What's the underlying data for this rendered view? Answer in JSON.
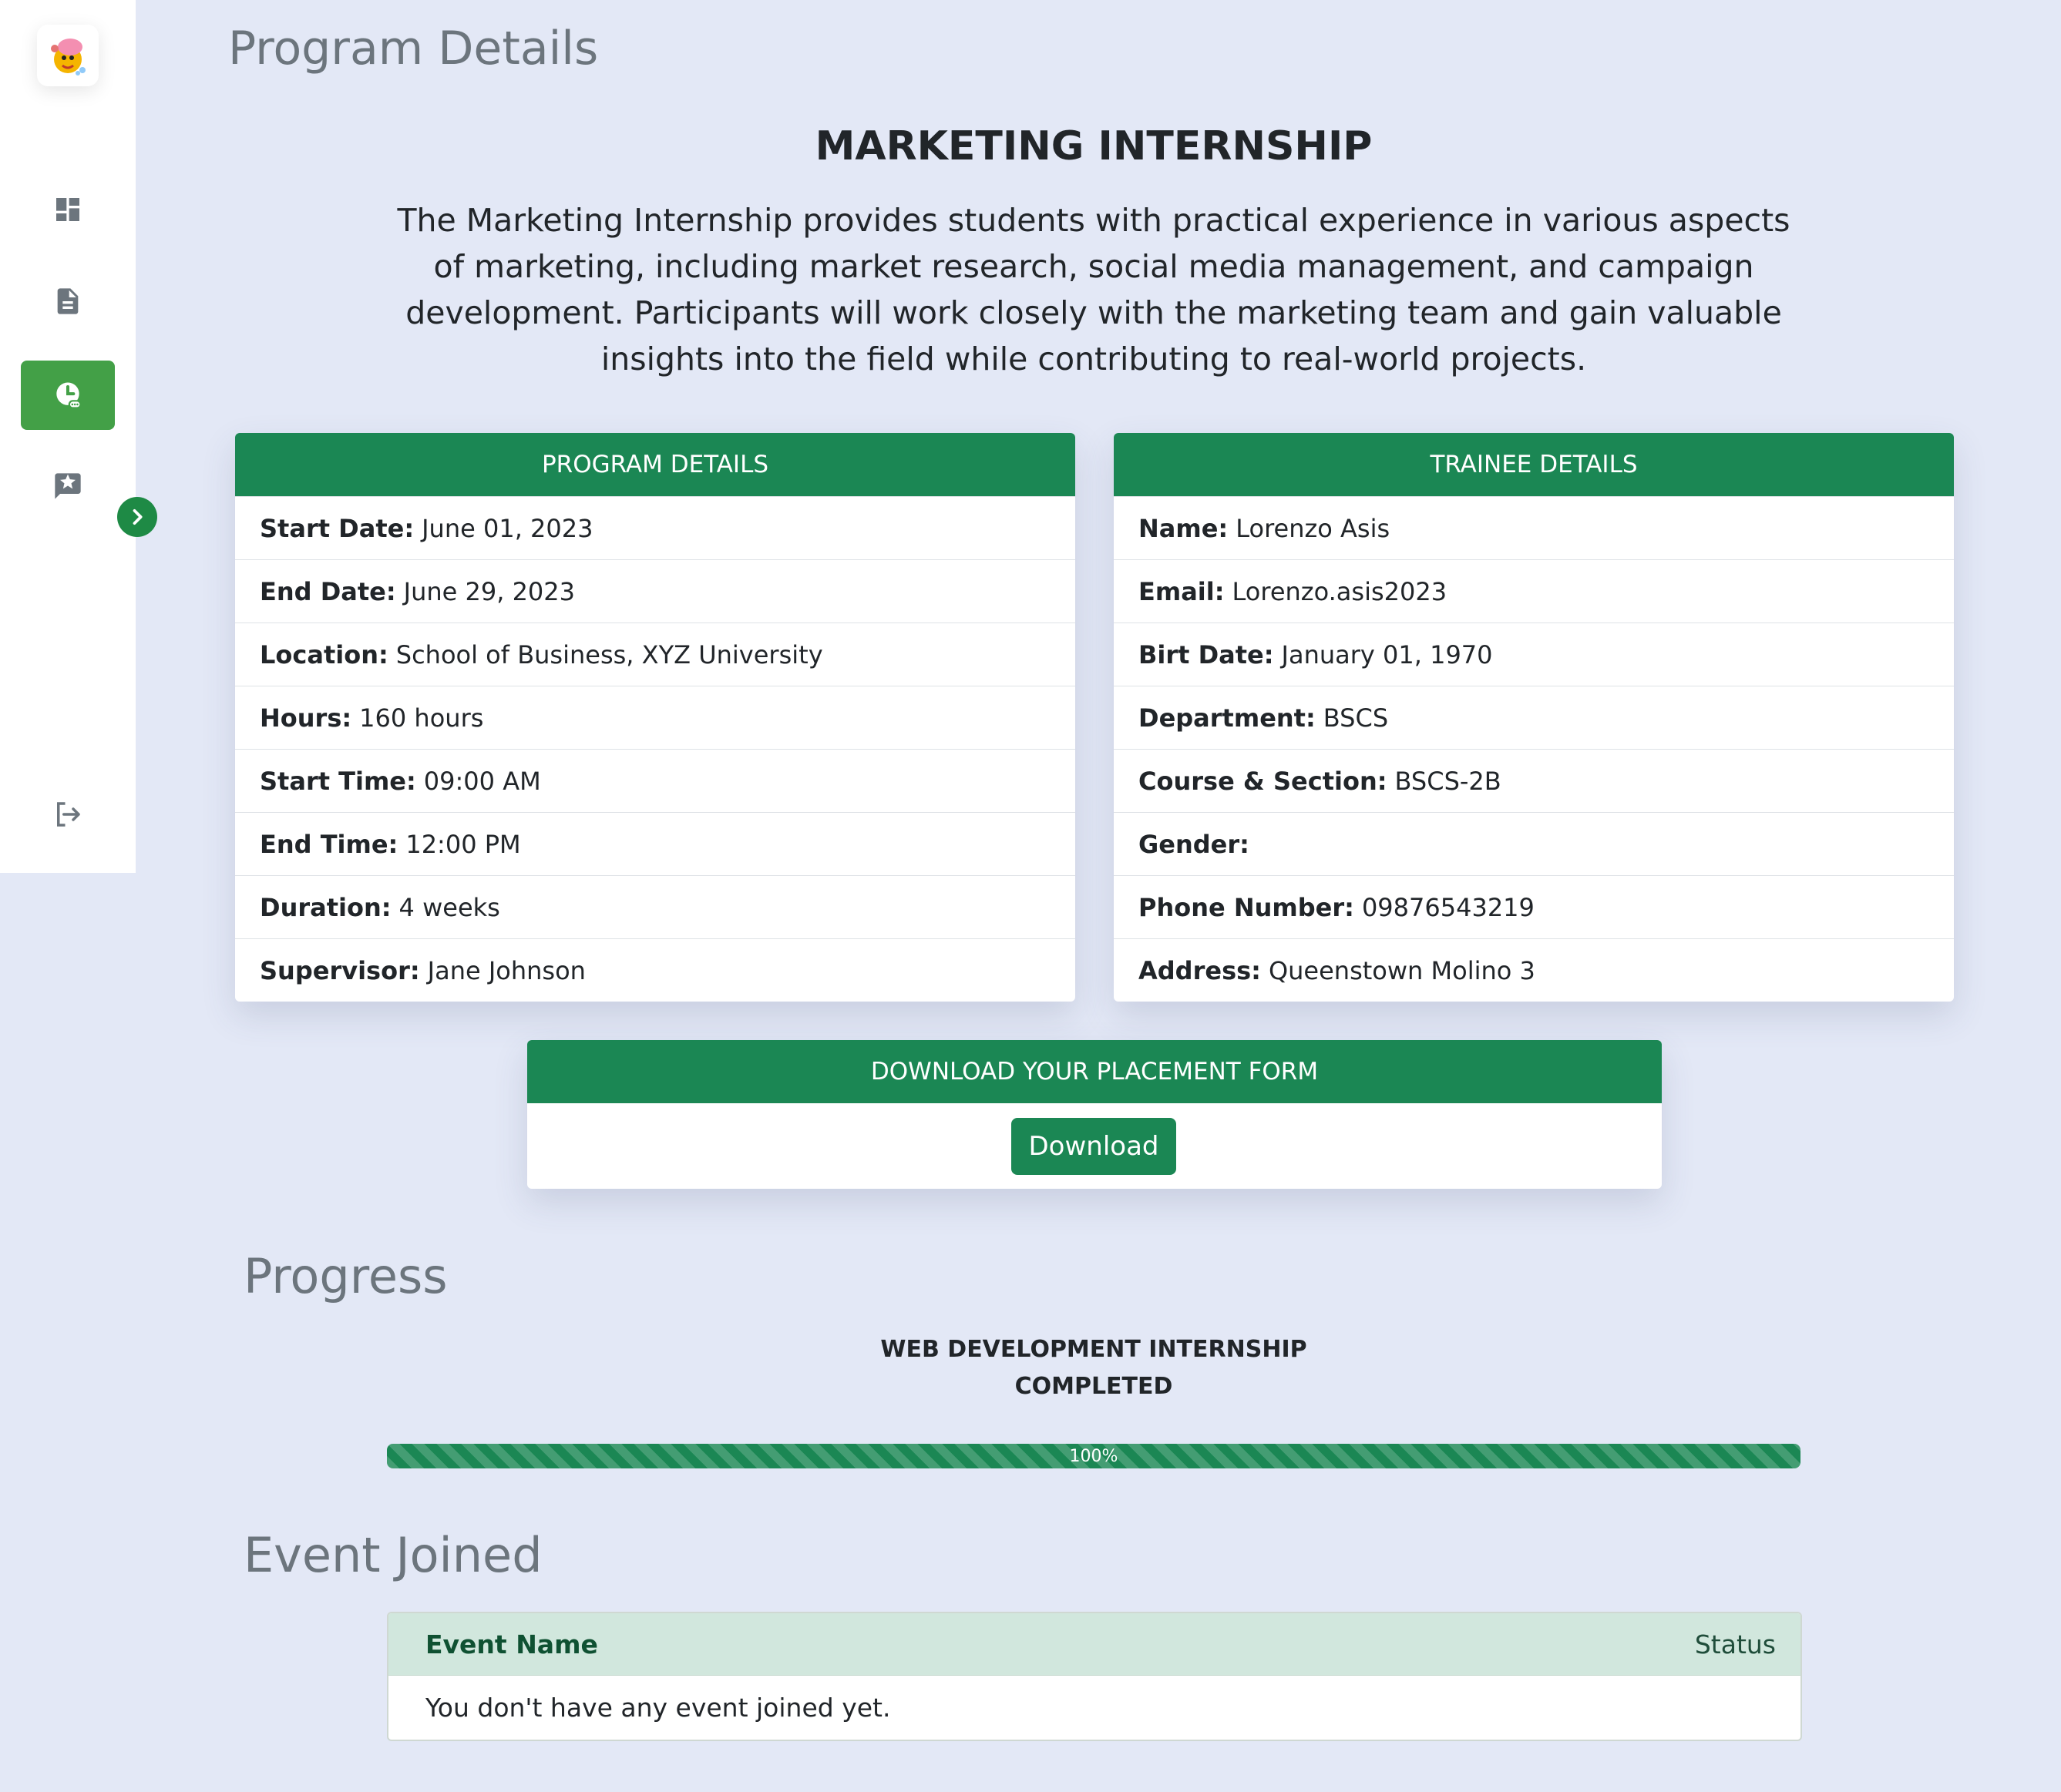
{
  "page": {
    "title": "Program Details"
  },
  "sidebar": {
    "items": [
      {
        "icon": "dashboard-icon"
      },
      {
        "icon": "document-icon"
      },
      {
        "icon": "clock-icon",
        "active": true
      },
      {
        "icon": "chat-star-icon"
      }
    ],
    "logout_icon": "logout-icon",
    "toggle_icon": "chevron-right-icon"
  },
  "program": {
    "name": "MARKETING INTERNSHIP",
    "description": "The Marketing Internship provides students with practical experience in various aspects of marketing, including market research, social media management, and campaign development. Participants will work closely with the marketing team and gain valuable insights into the field while contributing to real-world projects."
  },
  "program_details": {
    "header": "PROGRAM DETAILS",
    "rows": [
      {
        "label": "Start Date:",
        "value": "June 01, 2023"
      },
      {
        "label": "End Date:",
        "value": "June 29, 2023"
      },
      {
        "label": "Location:",
        "value": "School of Business, XYZ University"
      },
      {
        "label": "Hours:",
        "value": "160 hours"
      },
      {
        "label": "Start Time:",
        "value": "09:00 AM"
      },
      {
        "label": "End Time:",
        "value": "12:00 PM"
      },
      {
        "label": "Duration:",
        "value": "4 weeks"
      },
      {
        "label": "Supervisor:",
        "value": "Jane Johnson"
      }
    ]
  },
  "trainee_details": {
    "header": "TRAINEE DETAILS",
    "rows": [
      {
        "label": "Name:",
        "value": "Lorenzo Asis"
      },
      {
        "label": "Email:",
        "value": "Lorenzo.asis2023"
      },
      {
        "label": "Birt Date:",
        "value": "January 01, 1970"
      },
      {
        "label": "Department:",
        "value": "BSCS"
      },
      {
        "label": "Course & Section:",
        "value": "BSCS-2B"
      },
      {
        "label": "Gender:",
        "value": ""
      },
      {
        "label": "Phone Number:",
        "value": "09876543219"
      },
      {
        "label": "Address:",
        "value": "Queenstown Molino 3"
      }
    ]
  },
  "placement": {
    "header": "DOWNLOAD YOUR PLACEMENT FORM",
    "button_label": "Download"
  },
  "progress": {
    "title": "Progress",
    "program_name": "WEB DEVELOPMENT INTERNSHIP",
    "status": "COMPLETED",
    "percent_label": "100%",
    "percent": 100
  },
  "events": {
    "title": "Event Joined",
    "col_name": "Event Name",
    "col_status": "Status",
    "empty_message": "You don't have any event joined yet."
  },
  "colors": {
    "primary_green": "#1b8754",
    "active_sidebar": "#43a047",
    "background": "#e3e8f6"
  }
}
